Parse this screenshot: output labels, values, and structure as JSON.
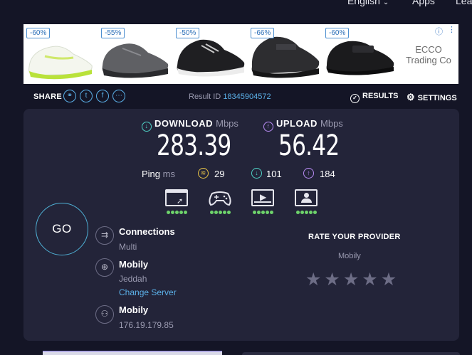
{
  "topnav": {
    "language": "English",
    "apps": "Apps",
    "learn": "Lea"
  },
  "ads": [
    {
      "discount": "-60%",
      "icon": "white-lime-running-shoe"
    },
    {
      "discount": "-55%",
      "icon": "grey-trail-shoe"
    },
    {
      "discount": "-50%",
      "icon": "black-white-sneaker"
    },
    {
      "discount": "-66%",
      "icon": "black-velcro-shoe"
    },
    {
      "discount": "-60%",
      "icon": "black-leather-velcro-shoe"
    }
  ],
  "ad_brand": {
    "line1": "ECCO",
    "line2": "Trading Co"
  },
  "share": {
    "label": "SHARE",
    "icons": [
      "link-icon",
      "twitter-icon",
      "facebook-icon",
      "more-icon"
    ]
  },
  "result": {
    "label": "Result ID",
    "id": "18345904572"
  },
  "buttons": {
    "results": "RESULTS",
    "settings": "SETTINGS",
    "go": "GO"
  },
  "download": {
    "label": "DOWNLOAD",
    "unit": "Mbps",
    "value": "283.39"
  },
  "upload": {
    "label": "UPLOAD",
    "unit": "Mbps",
    "value": "56.42"
  },
  "ping": {
    "label": "Ping",
    "unit": "ms",
    "idle": "29",
    "download": "101",
    "upload": "184"
  },
  "features": [
    {
      "icon": "browsing-icon",
      "rating_dots": 5
    },
    {
      "icon": "gaming-icon",
      "rating_dots": 5
    },
    {
      "icon": "video-streaming-icon",
      "rating_dots": 5
    },
    {
      "icon": "video-chat-icon",
      "rating_dots": 5
    }
  ],
  "connections": {
    "title": "Connections",
    "value": "Multi"
  },
  "server": {
    "title": "Mobily",
    "location": "Jeddah",
    "change_label": "Change Server"
  },
  "provider": {
    "title": "Mobily",
    "ip": "176.19.179.85"
  },
  "rating": {
    "title": "RATE YOUR PROVIDER",
    "provider": "Mobily",
    "stars": 5
  },
  "colors": {
    "background": "#141526",
    "card": "#232439",
    "accent": "#5bb0e8",
    "download": "#4fd1c5",
    "upload": "#b98cf5",
    "good": "#6ed36b"
  }
}
